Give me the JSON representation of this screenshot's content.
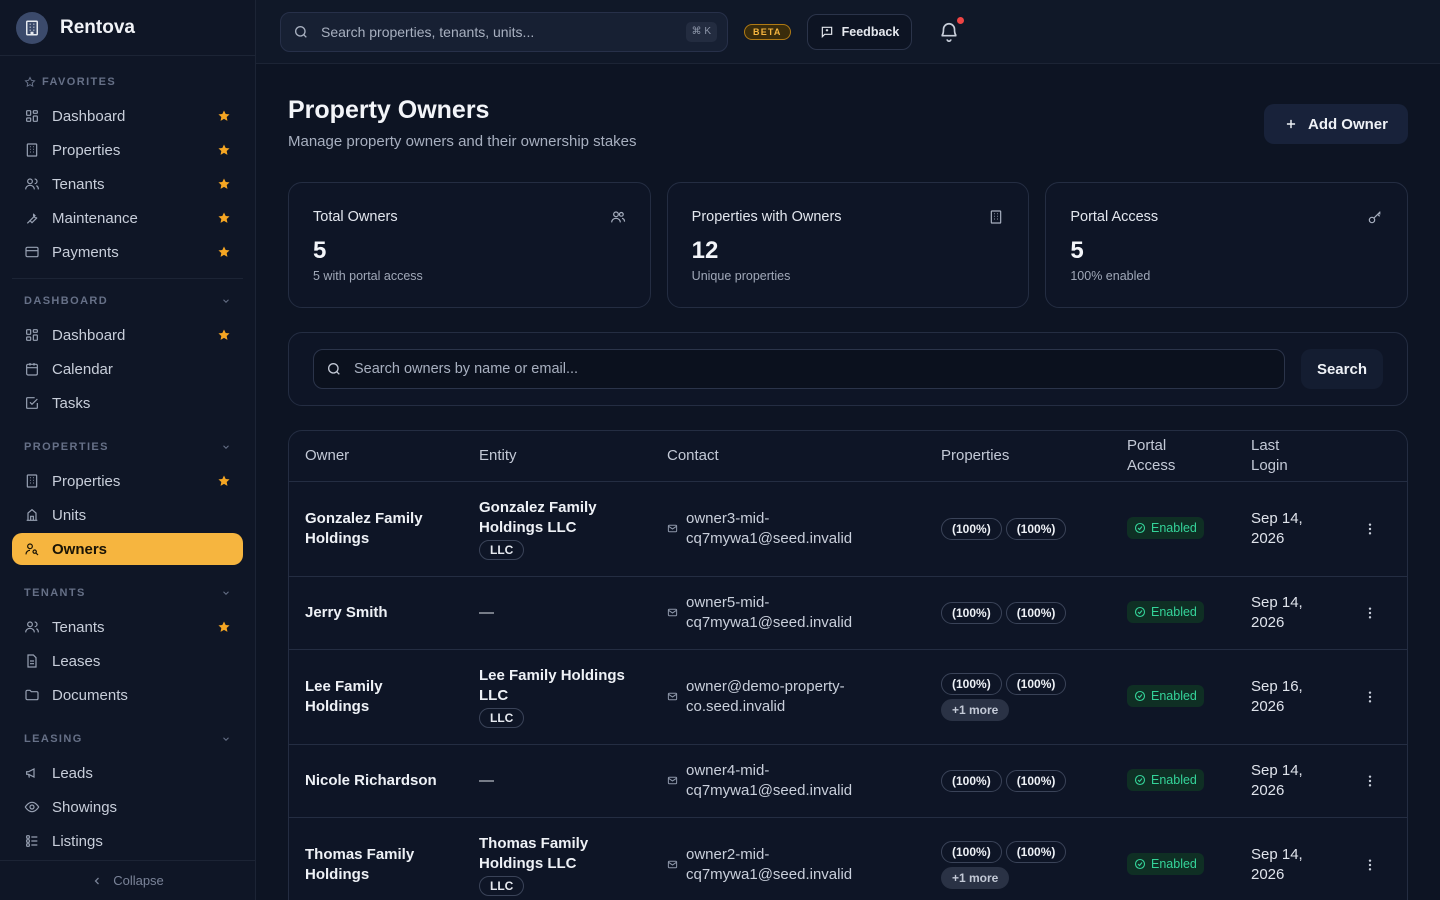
{
  "app": {
    "name": "Rentova"
  },
  "sidebar": {
    "favorites": {
      "label": "FAVORITES",
      "items": [
        {
          "label": "Dashboard",
          "icon": "grid-icon",
          "starred": true
        },
        {
          "label": "Properties",
          "icon": "building-icon",
          "starred": true
        },
        {
          "label": "Tenants",
          "icon": "users-icon",
          "starred": true
        },
        {
          "label": "Maintenance",
          "icon": "wrench-icon",
          "starred": true
        },
        {
          "label": "Payments",
          "icon": "credit-card-icon",
          "starred": true
        }
      ]
    },
    "dashboard": {
      "label": "DASHBOARD",
      "items": [
        {
          "label": "Dashboard",
          "icon": "grid-icon",
          "starred": true
        },
        {
          "label": "Calendar",
          "icon": "calendar-icon",
          "starred": false
        },
        {
          "label": "Tasks",
          "icon": "check-square-icon",
          "starred": false
        }
      ]
    },
    "properties": {
      "label": "PROPERTIES",
      "items": [
        {
          "label": "Properties",
          "icon": "building-icon",
          "starred": true
        },
        {
          "label": "Units",
          "icon": "columns-icon",
          "starred": false
        },
        {
          "label": "Owners",
          "icon": "user-key-icon",
          "starred": false,
          "active": true
        }
      ]
    },
    "tenants": {
      "label": "TENANTS",
      "items": [
        {
          "label": "Tenants",
          "icon": "users-icon",
          "starred": true
        },
        {
          "label": "Leases",
          "icon": "file-text-icon",
          "starred": false
        },
        {
          "label": "Documents",
          "icon": "folder-icon",
          "starred": false
        }
      ]
    },
    "leasing": {
      "label": "LEASING",
      "items": [
        {
          "label": "Leads",
          "icon": "megaphone-icon",
          "starred": false
        },
        {
          "label": "Showings",
          "icon": "eye-icon",
          "starred": false
        },
        {
          "label": "Listings",
          "icon": "list-icon",
          "starred": false
        }
      ]
    },
    "collapse_label": "Collapse"
  },
  "topbar": {
    "search_placeholder": "Search properties, tenants, units...",
    "shortcut": "⌘ K",
    "beta_label": "BETA",
    "feedback_label": "Feedback"
  },
  "page": {
    "title": "Property Owners",
    "subtitle": "Manage property owners and their ownership stakes",
    "add_button": "Add Owner"
  },
  "stats": [
    {
      "label": "Total Owners",
      "value": "5",
      "sub": "5 with portal access",
      "icon": "users-icon"
    },
    {
      "label": "Properties with Owners",
      "value": "12",
      "sub": "Unique properties",
      "icon": "building-icon"
    },
    {
      "label": "Portal Access",
      "value": "5",
      "sub": "100% enabled",
      "icon": "key-icon"
    }
  ],
  "filter": {
    "placeholder": "Search owners by name or email...",
    "button": "Search"
  },
  "table": {
    "headers": {
      "owner": "Owner",
      "entity": "Entity",
      "contact": "Contact",
      "properties": "Properties",
      "portal_line1": "Portal",
      "portal_line2": "Access",
      "login_line1": "Last",
      "login_line2": "Login"
    },
    "rows": [
      {
        "owner": "Gonzalez Family Holdings",
        "entity": "Gonzalez Family Holdings LLC",
        "entity_type": "LLC",
        "email": "owner3-mid-cq7mywa1@seed.invalid",
        "properties": [
          "(100%)",
          "(100%)"
        ],
        "more": "",
        "portal": "Enabled",
        "last_login": "Sep 14, 2026"
      },
      {
        "owner": "Jerry Smith",
        "entity": "—",
        "entity_type": "",
        "email": "owner5-mid-cq7mywa1@seed.invalid",
        "properties": [
          "(100%)",
          "(100%)"
        ],
        "more": "",
        "portal": "Enabled",
        "last_login": "Sep 14, 2026"
      },
      {
        "owner": "Lee Family Holdings",
        "entity": "Lee Family Holdings LLC",
        "entity_type": "LLC",
        "email": "owner@demo-property-co.seed.invalid",
        "properties": [
          "(100%)",
          "(100%)"
        ],
        "more": "+1 more",
        "portal": "Enabled",
        "last_login": "Sep 16, 2026"
      },
      {
        "owner": "Nicole Richardson",
        "entity": "—",
        "entity_type": "",
        "email": "owner4-mid-cq7mywa1@seed.invalid",
        "properties": [
          "(100%)",
          "(100%)"
        ],
        "more": "",
        "portal": "Enabled",
        "last_login": "Sep 14, 2026"
      },
      {
        "owner": "Thomas Family Holdings",
        "entity": "Thomas Family Holdings LLC",
        "entity_type": "LLC",
        "email": "owner2-mid-cq7mywa1@seed.invalid",
        "properties": [
          "(100%)",
          "(100%)"
        ],
        "more": "+1 more",
        "portal": "Enabled",
        "last_login": "Sep 14, 2026"
      }
    ]
  },
  "colors": {
    "accent": "#f6b53f",
    "star": "#f5a623",
    "success": "#34d399",
    "background": "#0d1423"
  }
}
